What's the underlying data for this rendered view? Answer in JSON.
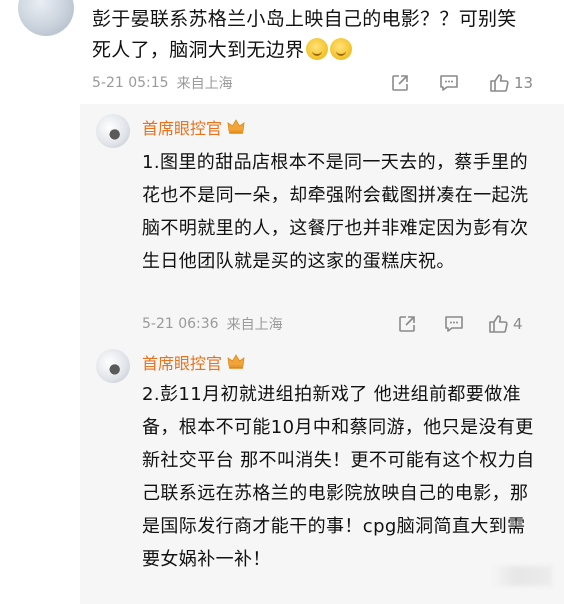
{
  "comment": {
    "text": "彭于晏联系苏格兰小岛上映自己的电影？？可别笑死人了，脑洞大到无边界",
    "date": "5-21 05:15",
    "location": "来自上海",
    "like_count": "13"
  },
  "replies": [
    {
      "name": "首席眼控官",
      "text": "1.图里的甜品店根本不是同一天去的，蔡手里的花也不是同一朵，却牵强附会截图拼凑在一起洗脑不明就里的人，这餐厅也并非难定因为彭有次生日他团队就是买的这家的蛋糕庆祝。",
      "date": "5-21 06:36",
      "location": "来自上海",
      "like_count": "4"
    },
    {
      "name": "首席眼控官",
      "text": "2.彭11月初就进组拍新戏了 他进组前都要做准备，根本不可能10月中和蔡同游，他只是没有更新社交平台 那不叫消失！更不可能有这个权力自己联系远在苏格兰的电影院放映自己的电影，那是国际发行商才能干的事！cpg脑洞简直大到需要女娲补一补！"
    }
  ],
  "icons": [
    "share-icon",
    "comment-icon",
    "like-icon",
    "crown-icon",
    "laugh-emoji-icon"
  ],
  "colors": {
    "reply_name": "#e8731f",
    "meta_text": "#9a9a9a",
    "reply_background": "#f6f6f6"
  }
}
